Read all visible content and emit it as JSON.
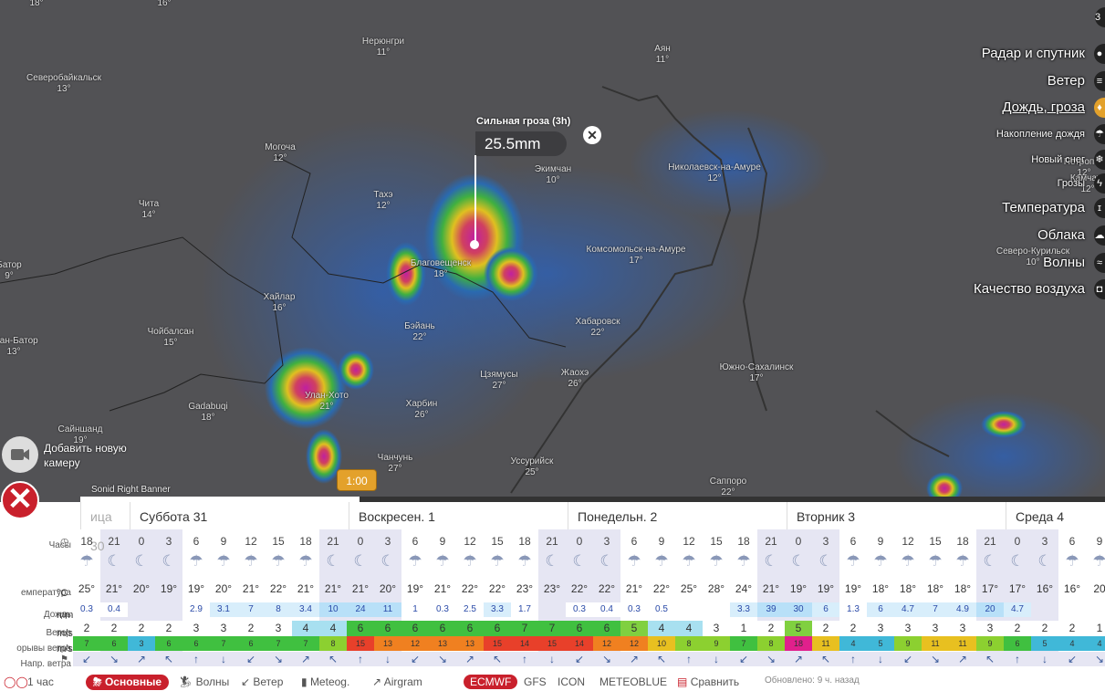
{
  "map": {
    "cities": [
      {
        "name": "Северобайкальск",
        "t": "13°"
      },
      {
        "name": "Нерюнгри",
        "t": "11°"
      },
      {
        "name": "Аян",
        "t": "11°"
      },
      {
        "name": "Могоча",
        "t": "12°"
      },
      {
        "name": "Экимчан",
        "t": "10°"
      },
      {
        "name": "Николаевск-на-Амуре",
        "t": "12°"
      },
      {
        "name": "Чита",
        "t": "14°"
      },
      {
        "name": "Тахэ",
        "t": "12°"
      },
      {
        "name": "Благовещенск",
        "t": "18°"
      },
      {
        "name": "Комсомольск-на-Амуре",
        "t": "17°"
      },
      {
        "name": "Батор",
        "t": "9°"
      },
      {
        "name": "Хайлар",
        "t": "16°"
      },
      {
        "name": "Северо-Курильск",
        "t": "10°"
      },
      {
        "name": "Чойбалсан",
        "t": "15°"
      },
      {
        "name": "Бэйань",
        "t": "22°"
      },
      {
        "name": "Хабаровск",
        "t": "22°"
      },
      {
        "name": "Улан-Батор",
        "t": "13°"
      },
      {
        "name": "Цзямусы",
        "t": "27°"
      },
      {
        "name": "Жаохэ",
        "t": "26°"
      },
      {
        "name": "Южно-Сахалинск",
        "t": "17°"
      },
      {
        "name": "Улан-Хото",
        "t": "21°"
      },
      {
        "name": "Gadabuqi",
        "t": "18°"
      },
      {
        "name": "Харбин",
        "t": "26°"
      },
      {
        "name": "Сайншанд",
        "t": "19°"
      },
      {
        "name": "Чанчунь",
        "t": "27°"
      },
      {
        "name": "Уссурийск",
        "t": "25°"
      },
      {
        "name": "Саппоро",
        "t": "22°"
      },
      {
        "name": "Петропав",
        "t": "12°"
      },
      {
        "name": "Камчатс",
        "t": "12°"
      }
    ],
    "corner_temps": [
      "18°",
      "16°"
    ],
    "tooltip": {
      "title": "Сильная гроза (3h)",
      "value": "25.5mm"
    },
    "camera_label_1": "Добавить новую",
    "camera_label_2": "камеру",
    "banner": "Sonid Right Banner",
    "time_bubble": "1:00"
  },
  "layers": [
    {
      "label": "Радар и спутник",
      "icon": "satellite-icon",
      "glyph": "●"
    },
    {
      "label": "Ветер",
      "icon": "wind-icon",
      "glyph": "≡"
    },
    {
      "label": "Дождь, гроза",
      "icon": "rain-drop-icon",
      "glyph": "♦",
      "active": true
    },
    {
      "label": "Накопление дождя",
      "icon": "rain-accum-icon",
      "glyph": "☂"
    },
    {
      "label": "Новый снег",
      "icon": "snow-icon",
      "glyph": "❄"
    },
    {
      "label": "Грозы",
      "icon": "lightning-icon",
      "glyph": "ϟ"
    },
    {
      "label": "Температура",
      "icon": "thermometer-icon",
      "glyph": "ɪ"
    },
    {
      "label": "Облака",
      "icon": "cloud-icon",
      "glyph": "☁"
    },
    {
      "label": "Волны",
      "icon": "waves-icon",
      "glyph": "≈"
    },
    {
      "label": "Качество воздуха",
      "icon": "air-quality-icon",
      "glyph": "◘"
    }
  ],
  "top_right": "3",
  "table": {
    "days": [
      "ица 30",
      "Суббота 31",
      "Воскресен. 1",
      "Понедельн. 2",
      "Вторник 3",
      "Среда 4"
    ],
    "labels": {
      "hours": "Часы",
      "temp": "емпература",
      "temp_unit": "°C",
      "rain": "Дождь",
      "rain_unit": "mm",
      "wind": "Ветер",
      "wind_unit": "m/s",
      "gusts": "орывы ветра",
      "gusts_unit": "m/s",
      "dir": "Напр. ветра"
    },
    "hours": [
      "18",
      "21",
      "0",
      "3",
      "6",
      "9",
      "12",
      "15",
      "18",
      "21",
      "0",
      "3",
      "6",
      "9",
      "12",
      "15",
      "18",
      "21",
      "0",
      "3",
      "6",
      "9",
      "12",
      "15",
      "18",
      "21",
      "0",
      "3",
      "6",
      "9",
      "12",
      "15",
      "18",
      "21",
      "0",
      "3",
      "6",
      "9"
    ],
    "temps": [
      "25°",
      "21°",
      "20°",
      "19°",
      "19°",
      "20°",
      "21°",
      "22°",
      "21°",
      "21°",
      "21°",
      "20°",
      "19°",
      "21°",
      "22°",
      "22°",
      "23°",
      "23°",
      "22°",
      "22°",
      "21°",
      "22°",
      "25°",
      "28°",
      "24°",
      "21°",
      "19°",
      "19°",
      "19°",
      "18°",
      "18°",
      "18°",
      "18°",
      "17°",
      "17°",
      "16°",
      "16°",
      "20"
    ],
    "rain": [
      "0.3",
      "0.4",
      "",
      "",
      "2.9",
      "3.1",
      "7",
      "8",
      "3.4",
      "10",
      "24",
      "11",
      "1",
      "0.3",
      "2.5",
      "3.3",
      "1.7",
      "",
      "0.3",
      "0.4",
      "0.3",
      "0.5",
      "",
      "",
      "3.3",
      "39",
      "30",
      "6",
      "1.3",
      "6",
      "4.7",
      "7",
      "4.9",
      "20",
      "4.7",
      "",
      "",
      ""
    ],
    "wind": [
      "2",
      "2",
      "2",
      "2",
      "3",
      "3",
      "2",
      "3",
      "4",
      "4",
      "6",
      "6",
      "6",
      "6",
      "6",
      "6",
      "7",
      "7",
      "6",
      "6",
      "5",
      "4",
      "4",
      "3",
      "1",
      "2",
      "5",
      "2",
      "2",
      "3",
      "3",
      "3",
      "3",
      "3",
      "2",
      "2",
      "2",
      "1"
    ],
    "gusts": [
      "7",
      "6",
      "3",
      "6",
      "6",
      "7",
      "6",
      "7",
      "7",
      "8",
      "15",
      "13",
      "12",
      "13",
      "13",
      "15",
      "14",
      "15",
      "14",
      "12",
      "12",
      "10",
      "8",
      "9",
      "7",
      "8",
      "18",
      "11",
      "4",
      "5",
      "9",
      "11",
      "11",
      "9",
      "6",
      "5",
      "4",
      "4"
    ]
  },
  "tabs": {
    "hours": "1 час",
    "main": "Основные",
    "waves": "Волны",
    "wind": "Ветер",
    "meteog": "Meteog.",
    "airgram": "Airgram",
    "ecmwf": "ECMWF",
    "gfs": "GFS",
    "icon": "ICON",
    "meteoblue": "METEOBLUE",
    "compare": "Сравнить",
    "updated": "Обновлено: 9 ч. назад"
  },
  "colors": {
    "accent": "#c9202c",
    "timebubble": "#e3a12b",
    "panel_active": "#e3a12b"
  }
}
